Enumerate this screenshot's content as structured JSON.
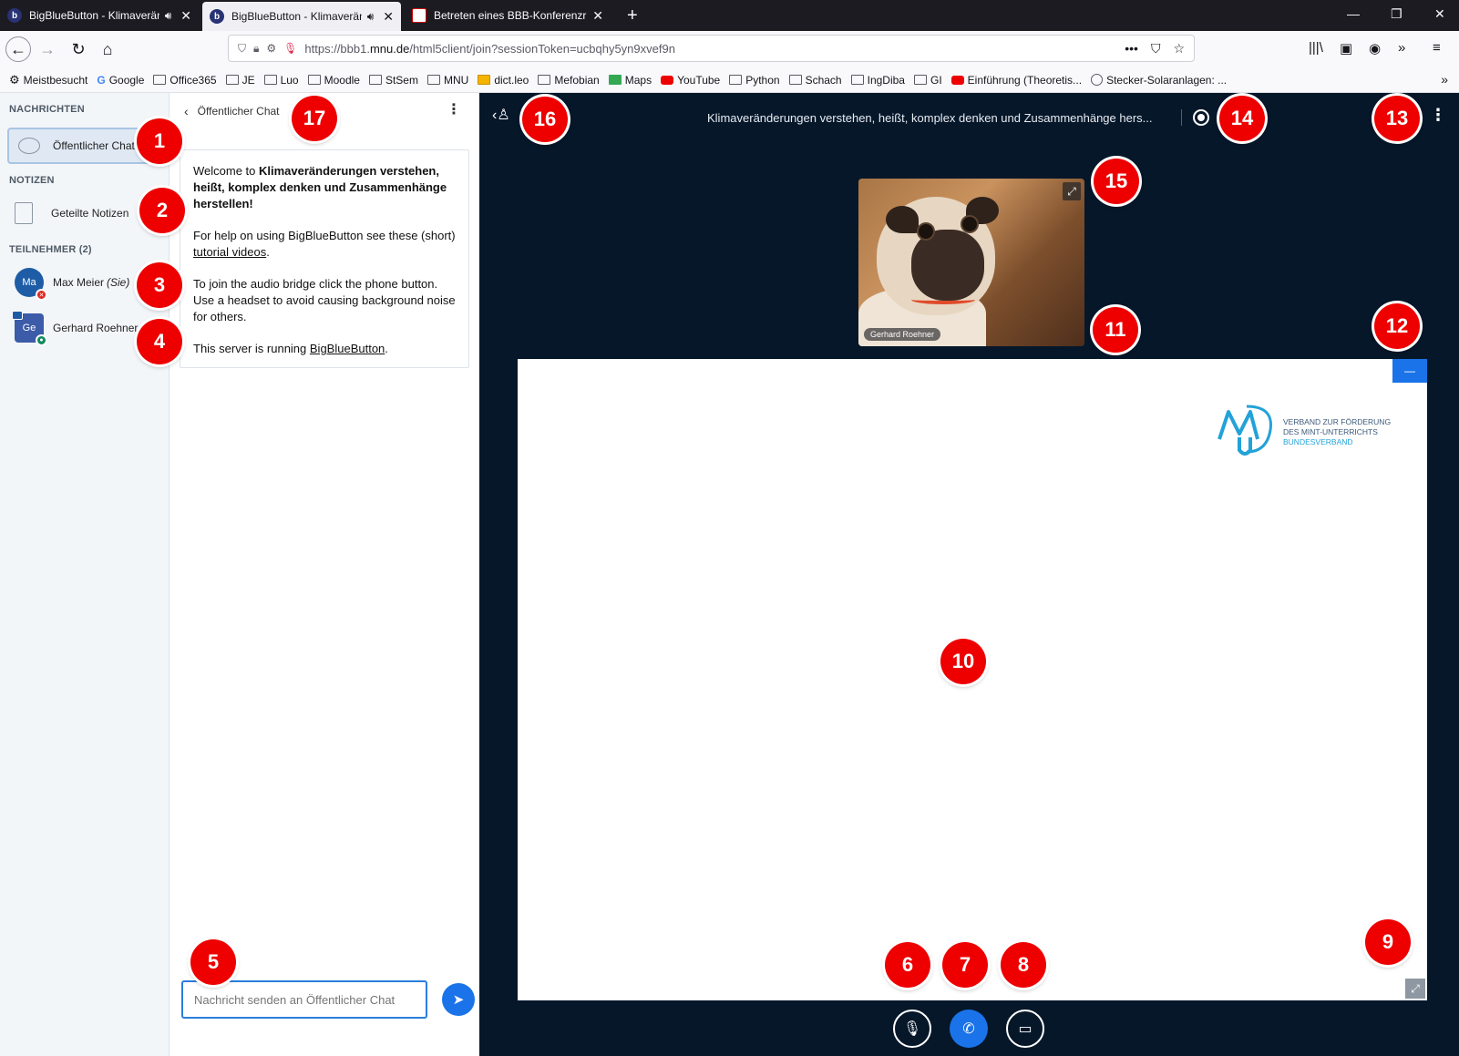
{
  "browser": {
    "tabs": [
      {
        "label": "BigBlueButton - Klimaverän",
        "active": false
      },
      {
        "label": "BigBlueButton - Klimaverän",
        "active": true
      },
      {
        "label": "Betreten eines BBB-Konferenzr",
        "active": false
      }
    ],
    "url_prefix": "https://bbb1.",
    "url_domain": "mnu.de",
    "url_path": "/html5client/join?sessionToken=ucbqhy5yn9xvef9n",
    "bookmarks": [
      "Meistbesucht",
      "Google",
      "Office365",
      "JE",
      "Luo",
      "Moodle",
      "StSem",
      "MNU",
      "dict.leo",
      "Mefobian",
      "Maps",
      "YouTube",
      "Python",
      "Schach",
      "IngDiba",
      "GI",
      "Einführung (Theoretis...",
      "Stecker-Solaranlagen: ..."
    ]
  },
  "userlist": {
    "messages_heading": "NACHRICHTEN",
    "public_chat": "Öffentlicher Chat",
    "notes_heading": "NOTIZEN",
    "shared_notes": "Geteilte Notizen",
    "participants_heading": "TEILNEHMER (2)",
    "users": [
      {
        "initials": "Ma",
        "name": "Max Meier",
        "suffix": "(Sie)"
      },
      {
        "initials": "Ge",
        "name": "Gerhard Roehner",
        "suffix": ""
      }
    ]
  },
  "chat": {
    "header": "Öffentlicher Chat",
    "welcome_prefix": "Welcome to ",
    "welcome_title": "Klimaveränderungen verstehen, heißt, komplex denken und Zusammenhänge herstellen!",
    "help_prefix": "For help on using BigBlueButton see these (short) ",
    "help_link": "tutorial videos",
    "help_suffix": ".",
    "audio_text": "To join the audio bridge click the phone button. Use a headset to avoid causing background noise for others.",
    "server_prefix": "This server is running ",
    "server_link": "BigBlueButton",
    "server_suffix": ".",
    "input_placeholder": "Nachricht senden an Öffentlicher Chat"
  },
  "main": {
    "title": "Klimaveränderungen verstehen, heißt, komplex denken und Zusammenhänge hers...",
    "webcam_name": "Gerhard Roehner",
    "logo_line1": "VERBAND ZUR FÖRDERUNG",
    "logo_line2": "DES MINT-UNTERRICHTS",
    "logo_line3": "BUNDESVERBAND"
  },
  "markers": [
    "1",
    "2",
    "3",
    "4",
    "5",
    "6",
    "7",
    "8",
    "9",
    "10",
    "11",
    "12",
    "13",
    "14",
    "15",
    "16",
    "17"
  ],
  "colors": {
    "marker": "#ee0000",
    "accent": "#1a73e8",
    "main_bg": "#06172a"
  }
}
